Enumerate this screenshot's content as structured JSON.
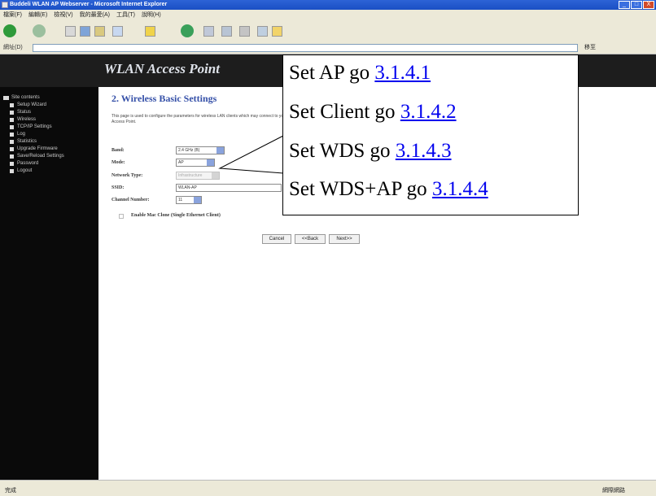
{
  "window": {
    "title": "Buddeli WLAN AP Webserver - Microsoft Internet Explorer",
    "buttons": [
      "_",
      "□",
      "X"
    ]
  },
  "menu": [
    "檔案(F)",
    "編輯(E)",
    "檢視(V)",
    "我的最愛(A)",
    "工具(T)",
    "說明(H)"
  ],
  "toolbar": {
    "icons": [
      "back-icon",
      "forward-icon",
      "stop-icon",
      "refresh-icon",
      "home-icon",
      "search-icon",
      "favorites-icon",
      "media-icon",
      "history-icon",
      "mail-icon",
      "print-icon",
      "edit-icon",
      "folder-icon"
    ]
  },
  "address": {
    "label": "網址(D)",
    "go": "移至"
  },
  "header": {
    "title": "WLAN Access Point"
  },
  "sidebar": {
    "items": [
      {
        "label": "Site contents",
        "folder": true
      },
      {
        "label": "Setup Wizard"
      },
      {
        "label": "Status"
      },
      {
        "label": "Wireless"
      },
      {
        "label": "TCP/IP Settings"
      },
      {
        "label": "Log"
      },
      {
        "label": "Statistics"
      },
      {
        "label": "Upgrade Firmware"
      },
      {
        "label": "Save/Reload Settings"
      },
      {
        "label": "Password"
      },
      {
        "label": "Logout"
      }
    ]
  },
  "main": {
    "section_title": "2. Wireless Basic Settings",
    "intro": "This page is used to configure the parameters for wireless LAN clients which may connect to your Access Point.",
    "fields": [
      {
        "label": "Band:",
        "value": "2.4 GHz (B)"
      },
      {
        "label": "Mode:",
        "value": "AP"
      },
      {
        "label": "Network Type:",
        "value": "Infrastructure"
      },
      {
        "label": "SSID:",
        "value": "WLAN-AP"
      },
      {
        "label": "Channel Number:",
        "value": "11"
      }
    ],
    "mac_clone": "Enable Mac Clone (Single Ethernet Client)",
    "buttons": [
      "Cancel",
      "<<Back",
      "Next>>"
    ]
  },
  "callout": {
    "lines": [
      {
        "text": "Set AP go ",
        "link": "3.1.4.1"
      },
      {
        "text": "Set Client go ",
        "link": "3.1.4.2"
      },
      {
        "text": "Set WDS go ",
        "link": "3.1.4.3"
      },
      {
        "text": "Set WDS+AP go ",
        "link": "3.1.4.4"
      }
    ]
  },
  "status": {
    "left": "完成",
    "right": "網際網路"
  }
}
